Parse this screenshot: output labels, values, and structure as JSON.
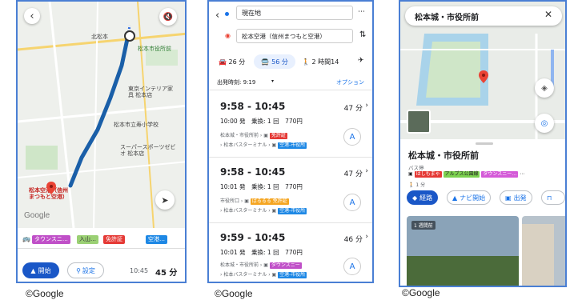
{
  "panel1": {
    "map_labels": {
      "hokuto": "北松本",
      "matsumoto_city": "松本市役所前",
      "tokyo_interior": "東京インテリア家具 松本店",
      "matsumoto_high": "松本市立寿小学校",
      "super_sports": "スーパースポーツゼビオ 松本店",
      "airport": "松本空港（信州まつもと空港）"
    },
    "route_bar": {
      "chips": [
        "タウンスニ…",
        "入山…",
        "免許証",
        "空港…"
      ]
    },
    "bottom": {
      "start_label": "開始",
      "settings_label": "設定",
      "eta": "10:45",
      "duration": "45 分"
    }
  },
  "panel2": {
    "origin": "現在地",
    "destination": "松本空港（信州まつもと空港）",
    "modes": {
      "car": "26 分",
      "transit": "56 分",
      "walk": "2 時間14"
    },
    "departure": "出発時刻: 9:19",
    "options": "オプション",
    "routes": [
      {
        "time": "9:58 - 10:45",
        "minutes": "47 分",
        "sub": "10:00 発　乗換: 1 回　770円",
        "stop1": "松本城・市役所前",
        "stop2": "松本バスターミナル",
        "chip1": "免許証",
        "chip2": "空港-市役所"
      },
      {
        "time": "9:58 - 10:45",
        "minutes": "47 分",
        "sub": "10:01 発　乗換: 1 回　770円",
        "stop1": "市役所口",
        "stop2": "松本バスターミナル",
        "chip1": "ぱるるる 免許証",
        "chip2": "空港-市役所"
      },
      {
        "time": "9:59 - 10:45",
        "minutes": "46 分",
        "sub": "10:01 発　乗換: 1 回　770円",
        "stop1": "松本城・市役所前",
        "stop2": "松本バスターミナル",
        "chip1": "タウンスニー",
        "chip2": "空港-市役所"
      }
    ]
  },
  "panel3": {
    "search_title": "松本城・市役所前",
    "place_name": "松本城・市役所前",
    "place_type": "バス停",
    "walk": "1 分",
    "routes_chips": [
      "はしもまゃ",
      "アルプス公園線",
      "タウンスニー…"
    ],
    "actions": [
      "経路",
      "ナビ開始",
      "出発"
    ],
    "photo_badge": "1 週間前"
  },
  "credits": [
    "©Google",
    "©Google",
    "©Google"
  ]
}
